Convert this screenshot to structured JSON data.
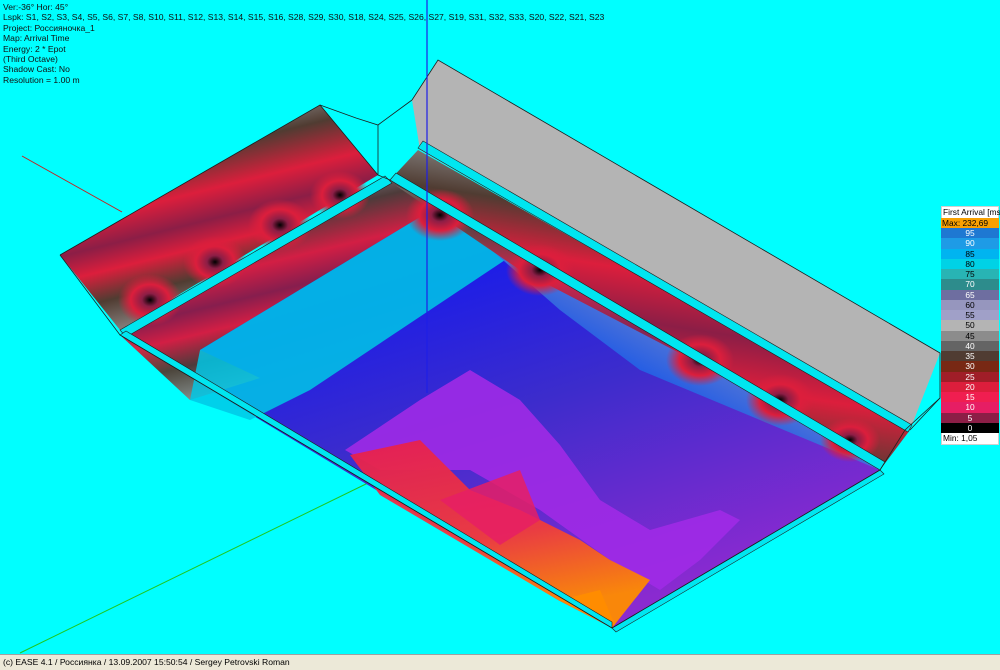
{
  "info": {
    "line1": "Ver:-36°   Hor: 45°",
    "line2": "Lspk: S1, S2, S3, S4, S5, S6, S7, S8, S10, S11, S12, S13, S14, S15, S16, S28, S29, S30, S18, S24, S25, S26, S27, S19, S31, S32, S33, S20, S22, S21, S23",
    "line3": "Project: Россияночка_1",
    "line4": "Map: Arrival Time",
    "line5": "Energy: 2 * Epot",
    "line6": "(Third Octave)",
    "line7": "Shadow Cast: No",
    "line8": "Resolution =   1.00 m"
  },
  "legend": {
    "title": "First Arrival [ms]",
    "max_label": "Max:  232,69",
    "min_label": "Min:  1,05",
    "colors": {
      "95": "#1e78d2",
      "90": "#1e9be6",
      "85": "#00b4f0",
      "80": "#00d2e6",
      "75": "#28b4b4",
      "70": "#2d8c8c",
      "65": "#6e6ea0",
      "60": "#9696be",
      "55": "#a0a0c8",
      "50": "#b4b4b4",
      "45": "#8c8c8c",
      "40": "#646464",
      "35": "#503c32",
      "30": "#782814",
      "25": "#a01e28",
      "20": "#dc1e3c",
      "15": "#f01e50",
      "10": "#e61e64",
      "5": "#8c1e46",
      "0": "#000000"
    },
    "rows": [
      {
        "label": "95",
        "color": "#1e78d2",
        "text": "#ffffff"
      },
      {
        "label": "90",
        "color": "#1e9be6",
        "text": "#ffffff"
      },
      {
        "label": "85",
        "color": "#00b4f0",
        "text": "#000000"
      },
      {
        "label": "80",
        "color": "#00d2e6",
        "text": "#000000"
      },
      {
        "label": "75",
        "color": "#28b4b4",
        "text": "#000000"
      },
      {
        "label": "70",
        "color": "#2d8c8c",
        "text": "#ffffff"
      },
      {
        "label": "65",
        "color": "#6e6ea0",
        "text": "#ffffff"
      },
      {
        "label": "60",
        "color": "#9696be",
        "text": "#000000"
      },
      {
        "label": "55",
        "color": "#a0a0c8",
        "text": "#000000"
      },
      {
        "label": "50",
        "color": "#b4b4b4",
        "text": "#000000"
      },
      {
        "label": "45",
        "color": "#8c8c8c",
        "text": "#000000"
      },
      {
        "label": "40",
        "color": "#646464",
        "text": "#ffffff"
      },
      {
        "label": "35",
        "color": "#503c32",
        "text": "#ffffff"
      },
      {
        "label": "30",
        "color": "#782814",
        "text": "#ffffff"
      },
      {
        "label": "25",
        "color": "#a01e28",
        "text": "#ffffff"
      },
      {
        "label": "20",
        "color": "#dc1e3c",
        "text": "#ffffff"
      },
      {
        "label": "15",
        "color": "#f01e50",
        "text": "#ffffff"
      },
      {
        "label": "10",
        "color": "#e61e64",
        "text": "#ffffff"
      },
      {
        "label": "5",
        "color": "#8c1e46",
        "text": "#ffffff"
      },
      {
        "label": "0",
        "color": "#000000",
        "text": "#ffffff"
      }
    ],
    "max_color": "#f8a000"
  },
  "scene": {
    "background": "#00ffff",
    "floor_colors": [
      "#1e1ee6",
      "#1e5ae6",
      "#3c3cc8",
      "#8c28d2",
      "#b428f0",
      "#e61e50",
      "#ff8c00"
    ],
    "wall_colors": [
      "#b4b4b4",
      "#8c1e46",
      "#dc1e3c",
      "#503c32",
      "#8c8c8c"
    ],
    "line_color": "#1e1e1e"
  },
  "status": {
    "text": "(c) EASE 4.1  / Россиянка  / 13.09.2007 15:50:54 / Sergey Petrovski Roman"
  }
}
